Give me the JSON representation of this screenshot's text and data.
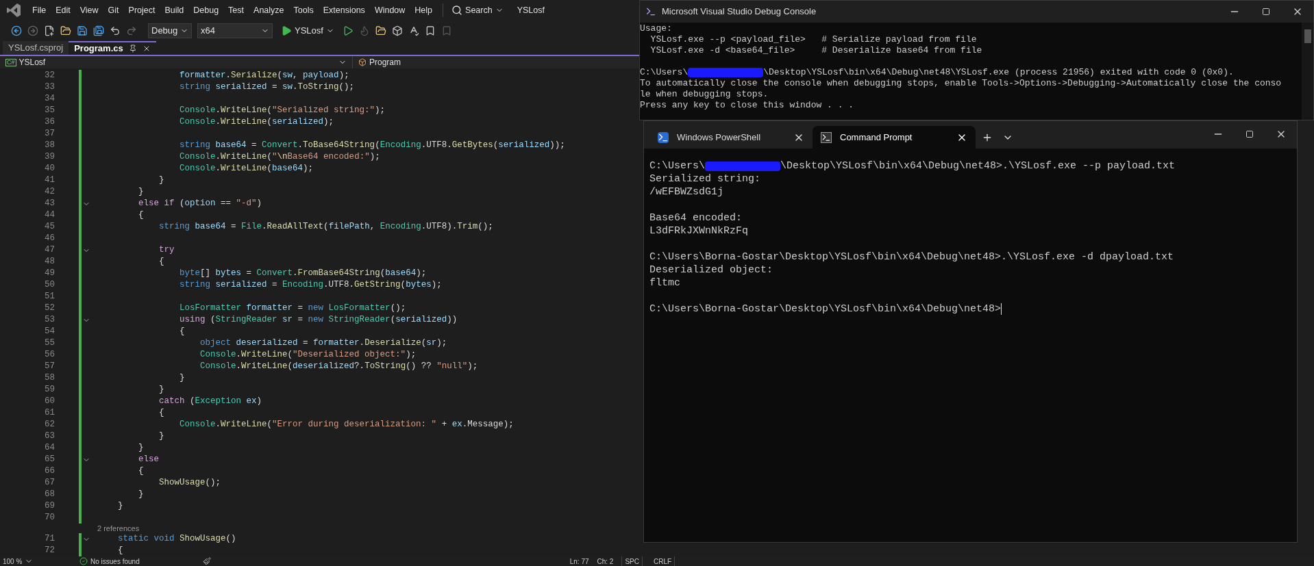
{
  "menu": [
    "File",
    "Edit",
    "View",
    "Git",
    "Project",
    "Build",
    "Debug",
    "Test",
    "Analyze",
    "Tools",
    "Extensions",
    "Window",
    "Help"
  ],
  "search": "Search",
  "solution_name": "YSLosf",
  "toolbar": {
    "configuration": "Debug",
    "platform": "x64",
    "run_target": "YSLosf"
  },
  "tabs": [
    {
      "label": "YSLosf.csproj",
      "selected": false
    },
    {
      "label": "Program.cs",
      "selected": true
    }
  ],
  "nav_bar": {
    "language_badge": "C#",
    "project": "YSLosf",
    "member": "Program"
  },
  "editor": {
    "lines": [
      {
        "n": "32",
        "fold": false,
        "tokens": [
          {
            "kind": "var",
            "text": "                formatter"
          },
          {
            "kind": "pl",
            "text": "."
          },
          {
            "kind": "m",
            "text": "Serialize"
          },
          {
            "kind": "pl",
            "text": "("
          },
          {
            "kind": "var",
            "text": "sw"
          },
          {
            "kind": "pl",
            "text": ", "
          },
          {
            "kind": "var",
            "text": "payload"
          },
          {
            "kind": "pl",
            "text": ");"
          }
        ]
      },
      {
        "n": "33",
        "fold": false,
        "tokens": [
          {
            "kind": "kw",
            "text": "                string"
          },
          {
            "kind": "var",
            "text": " serialized"
          },
          {
            "kind": "pl",
            "text": " = "
          },
          {
            "kind": "var",
            "text": "sw"
          },
          {
            "kind": "pl",
            "text": "."
          },
          {
            "kind": "m",
            "text": "ToString"
          },
          {
            "kind": "pl",
            "text": "();"
          }
        ]
      },
      {
        "n": "34",
        "fold": false
      },
      {
        "n": "35",
        "fold": false,
        "tokens": [
          {
            "kind": "ty",
            "text": "                Console"
          },
          {
            "kind": "pl",
            "text": "."
          },
          {
            "kind": "m",
            "text": "WriteLine"
          },
          {
            "kind": "pl",
            "text": "("
          },
          {
            "kind": "s",
            "text": "\"Serialized string:\""
          },
          {
            "kind": "pl",
            "text": ");"
          }
        ]
      },
      {
        "n": "36",
        "fold": false,
        "tokens": [
          {
            "kind": "ty",
            "text": "                Console"
          },
          {
            "kind": "pl",
            "text": "."
          },
          {
            "kind": "m",
            "text": "WriteLine"
          },
          {
            "kind": "pl",
            "text": "("
          },
          {
            "kind": "var",
            "text": "serialized"
          },
          {
            "kind": "pl",
            "text": ");"
          }
        ]
      },
      {
        "n": "37",
        "fold": false
      },
      {
        "n": "38",
        "fold": false,
        "tokens": [
          {
            "kind": "kw",
            "text": "                string"
          },
          {
            "kind": "var",
            "text": " base64"
          },
          {
            "kind": "pl",
            "text": " = "
          },
          {
            "kind": "ty",
            "text": "Convert"
          },
          {
            "kind": "pl",
            "text": "."
          },
          {
            "kind": "m",
            "text": "ToBase64String"
          },
          {
            "kind": "pl",
            "text": "("
          },
          {
            "kind": "ty",
            "text": "Encoding"
          },
          {
            "kind": "pl",
            "text": ".UTF8."
          },
          {
            "kind": "m",
            "text": "GetBytes"
          },
          {
            "kind": "pl",
            "text": "("
          },
          {
            "kind": "var",
            "text": "serialized"
          },
          {
            "kind": "pl",
            "text": "));"
          }
        ]
      },
      {
        "n": "39",
        "fold": false,
        "tokens": [
          {
            "kind": "ty",
            "text": "                Console"
          },
          {
            "kind": "pl",
            "text": "."
          },
          {
            "kind": "m",
            "text": "WriteLine"
          },
          {
            "kind": "pl",
            "text": "("
          },
          {
            "kind": "s",
            "text": "\""
          },
          {
            "kind": "esc",
            "text": "\\n"
          },
          {
            "kind": "s",
            "text": "Base64 encoded:\""
          },
          {
            "kind": "pl",
            "text": ");"
          }
        ]
      },
      {
        "n": "40",
        "fold": false,
        "tokens": [
          {
            "kind": "ty",
            "text": "                Console"
          },
          {
            "kind": "pl",
            "text": "."
          },
          {
            "kind": "m",
            "text": "WriteLine"
          },
          {
            "kind": "pl",
            "text": "("
          },
          {
            "kind": "var",
            "text": "base64"
          },
          {
            "kind": "pl",
            "text": ");"
          }
        ]
      },
      {
        "n": "41",
        "fold": false,
        "tokens": [
          {
            "kind": "pl",
            "text": "            }"
          }
        ]
      },
      {
        "n": "42",
        "fold": false,
        "tokens": [
          {
            "kind": "pl",
            "text": "        }"
          }
        ]
      },
      {
        "n": "43",
        "fold": true,
        "tokens": [
          {
            "kind": "ctl",
            "text": "        else if"
          },
          {
            "kind": "pl",
            "text": " ("
          },
          {
            "kind": "var",
            "text": "option"
          },
          {
            "kind": "pl",
            "text": " == "
          },
          {
            "kind": "s",
            "text": "\"-d\""
          },
          {
            "kind": "pl",
            "text": ")"
          }
        ]
      },
      {
        "n": "44",
        "fold": false,
        "tokens": [
          {
            "kind": "pl",
            "text": "        {"
          }
        ]
      },
      {
        "n": "45",
        "fold": false,
        "tokens": [
          {
            "kind": "kw",
            "text": "            string"
          },
          {
            "kind": "var",
            "text": " base64"
          },
          {
            "kind": "pl",
            "text": " = "
          },
          {
            "kind": "ty",
            "text": "File"
          },
          {
            "kind": "pl",
            "text": "."
          },
          {
            "kind": "m",
            "text": "ReadAllText"
          },
          {
            "kind": "pl",
            "text": "("
          },
          {
            "kind": "var",
            "text": "filePath"
          },
          {
            "kind": "pl",
            "text": ", "
          },
          {
            "kind": "ty",
            "text": "Encoding"
          },
          {
            "kind": "pl",
            "text": ".UTF8)."
          },
          {
            "kind": "m",
            "text": "Trim"
          },
          {
            "kind": "pl",
            "text": "();"
          }
        ]
      },
      {
        "n": "46",
        "fold": false
      },
      {
        "n": "47",
        "fold": true,
        "tokens": [
          {
            "kind": "ctl",
            "text": "            try"
          }
        ]
      },
      {
        "n": "48",
        "fold": false,
        "tokens": [
          {
            "kind": "pl",
            "text": "            {"
          }
        ]
      },
      {
        "n": "49",
        "fold": false,
        "tokens": [
          {
            "kind": "kw",
            "text": "                byte"
          },
          {
            "kind": "pl",
            "text": "[] "
          },
          {
            "kind": "var",
            "text": "bytes"
          },
          {
            "kind": "pl",
            "text": " = "
          },
          {
            "kind": "ty",
            "text": "Convert"
          },
          {
            "kind": "pl",
            "text": "."
          },
          {
            "kind": "m",
            "text": "FromBase64String"
          },
          {
            "kind": "pl",
            "text": "("
          },
          {
            "kind": "var",
            "text": "base64"
          },
          {
            "kind": "pl",
            "text": ");"
          }
        ]
      },
      {
        "n": "50",
        "fold": false,
        "tokens": [
          {
            "kind": "kw",
            "text": "                string"
          },
          {
            "kind": "var",
            "text": " serialized"
          },
          {
            "kind": "pl",
            "text": " = "
          },
          {
            "kind": "ty",
            "text": "Encoding"
          },
          {
            "kind": "pl",
            "text": ".UTF8."
          },
          {
            "kind": "m",
            "text": "GetString"
          },
          {
            "kind": "pl",
            "text": "("
          },
          {
            "kind": "var",
            "text": "bytes"
          },
          {
            "kind": "pl",
            "text": ");"
          }
        ]
      },
      {
        "n": "51",
        "fold": false
      },
      {
        "n": "52",
        "fold": false,
        "tokens": [
          {
            "kind": "ty",
            "text": "                LosFormatter"
          },
          {
            "kind": "var",
            "text": " formatter"
          },
          {
            "kind": "pl",
            "text": " = "
          },
          {
            "kind": "kw",
            "text": "new"
          },
          {
            "kind": "ty",
            "text": " LosFormatter"
          },
          {
            "kind": "pl",
            "text": "();"
          }
        ]
      },
      {
        "n": "53",
        "fold": true,
        "tokens": [
          {
            "kind": "ctl",
            "text": "                using"
          },
          {
            "kind": "pl",
            "text": " ("
          },
          {
            "kind": "ty",
            "text": "StringReader"
          },
          {
            "kind": "var",
            "text": " sr"
          },
          {
            "kind": "pl",
            "text": " = "
          },
          {
            "kind": "kw",
            "text": "new"
          },
          {
            "kind": "ty",
            "text": " StringReader"
          },
          {
            "kind": "pl",
            "text": "("
          },
          {
            "kind": "var",
            "text": "serialized"
          },
          {
            "kind": "pl",
            "text": "))"
          }
        ]
      },
      {
        "n": "54",
        "fold": false,
        "tokens": [
          {
            "kind": "pl",
            "text": "                {"
          }
        ]
      },
      {
        "n": "55",
        "fold": false,
        "tokens": [
          {
            "kind": "kw",
            "text": "                    object"
          },
          {
            "kind": "var",
            "text": " deserialized"
          },
          {
            "kind": "pl",
            "text": " = "
          },
          {
            "kind": "var",
            "text": "formatter"
          },
          {
            "kind": "pl",
            "text": "."
          },
          {
            "kind": "m",
            "text": "Deserialize"
          },
          {
            "kind": "pl",
            "text": "("
          },
          {
            "kind": "var",
            "text": "sr"
          },
          {
            "kind": "pl",
            "text": ");"
          }
        ]
      },
      {
        "n": "56",
        "fold": false,
        "tokens": [
          {
            "kind": "ty",
            "text": "                    Console"
          },
          {
            "kind": "pl",
            "text": "."
          },
          {
            "kind": "m",
            "text": "WriteLine"
          },
          {
            "kind": "pl",
            "text": "("
          },
          {
            "kind": "s",
            "text": "\"Deserialized object:\""
          },
          {
            "kind": "pl",
            "text": ");"
          }
        ]
      },
      {
        "n": "57",
        "fold": false,
        "tokens": [
          {
            "kind": "ty",
            "text": "                    Console"
          },
          {
            "kind": "pl",
            "text": "."
          },
          {
            "kind": "m",
            "text": "WriteLine"
          },
          {
            "kind": "pl",
            "text": "("
          },
          {
            "kind": "var",
            "text": "deserialized"
          },
          {
            "kind": "pl",
            "text": "?."
          },
          {
            "kind": "m",
            "text": "ToString"
          },
          {
            "kind": "pl",
            "text": "() ?? "
          },
          {
            "kind": "s",
            "text": "\"null\""
          },
          {
            "kind": "pl",
            "text": ");"
          }
        ]
      },
      {
        "n": "58",
        "fold": false,
        "tokens": [
          {
            "kind": "pl",
            "text": "                }"
          }
        ]
      },
      {
        "n": "59",
        "fold": false,
        "tokens": [
          {
            "kind": "pl",
            "text": "            }"
          }
        ]
      },
      {
        "n": "60",
        "fold": false,
        "tokens": [
          {
            "kind": "ctl",
            "text": "            catch"
          },
          {
            "kind": "pl",
            "text": " ("
          },
          {
            "kind": "ty",
            "text": "Exception"
          },
          {
            "kind": "var",
            "text": " ex"
          },
          {
            "kind": "pl",
            "text": ")"
          }
        ]
      },
      {
        "n": "61",
        "fold": false,
        "tokens": [
          {
            "kind": "pl",
            "text": "            {"
          }
        ]
      },
      {
        "n": "62",
        "fold": false,
        "tokens": [
          {
            "kind": "ty",
            "text": "                Console"
          },
          {
            "kind": "pl",
            "text": "."
          },
          {
            "kind": "m",
            "text": "WriteLine"
          },
          {
            "kind": "pl",
            "text": "("
          },
          {
            "kind": "s",
            "text": "\"Error during deserialization: \""
          },
          {
            "kind": "pl",
            "text": " + "
          },
          {
            "kind": "var",
            "text": "ex"
          },
          {
            "kind": "pl",
            "text": ".Message);"
          }
        ]
      },
      {
        "n": "63",
        "fold": false,
        "tokens": [
          {
            "kind": "pl",
            "text": "            }"
          }
        ]
      },
      {
        "n": "64",
        "fold": false,
        "tokens": [
          {
            "kind": "pl",
            "text": "        }"
          }
        ]
      },
      {
        "n": "65",
        "fold": true,
        "tokens": [
          {
            "kind": "ctl",
            "text": "        else"
          }
        ]
      },
      {
        "n": "66",
        "fold": false,
        "tokens": [
          {
            "kind": "pl",
            "text": "        {"
          }
        ]
      },
      {
        "n": "67",
        "fold": false,
        "tokens": [
          {
            "kind": "m",
            "text": "            ShowUsage"
          },
          {
            "kind": "pl",
            "text": "();"
          }
        ]
      },
      {
        "n": "68",
        "fold": false,
        "tokens": [
          {
            "kind": "pl",
            "text": "        }"
          }
        ]
      },
      {
        "n": "69",
        "fold": false,
        "tokens": [
          {
            "kind": "pl",
            "text": "    }"
          }
        ]
      },
      {
        "n": "70",
        "fold": false
      },
      {
        "n": "71",
        "fold": true,
        "codelens": "2 references",
        "tokens": [
          {
            "kind": "kw",
            "text": "    static void"
          },
          {
            "kind": "m",
            "text": " ShowUsage"
          },
          {
            "kind": "pl",
            "text": "()"
          }
        ]
      },
      {
        "n": "72",
        "fold": false,
        "tokens": [
          {
            "kind": "pl",
            "text": "    {"
          }
        ]
      }
    ]
  },
  "status_bar": {
    "zoom": "100 %",
    "issues": "No issues found",
    "line": "Ln: 77",
    "column": "Ch: 2",
    "whitespace": "SPC",
    "line_ending": "CRLF"
  },
  "debug_console": {
    "title": "Microsoft Visual Studio Debug Console",
    "lines": [
      {
        "kind": "text",
        "text": "Usage:"
      },
      {
        "kind": "text",
        "text": "  YSLosf.exe --p <payload_file>   # Serialize payload from file"
      },
      {
        "kind": "text",
        "text": "  YSLosf.exe -d <base64_file>     # Deserialize base64 from file"
      },
      {
        "kind": "blank"
      },
      {
        "kind": "redacted",
        "before": "C:\\Users\\",
        "after": "\\Desktop\\YSLosf\\bin\\x64\\Debug\\net48\\YSLosf.exe (process 21956) exited with code 0 (0x0)."
      },
      {
        "kind": "text",
        "text": "To automatically close the console when debugging stops, enable Tools->Options->Debugging->Automatically close the conso"
      },
      {
        "kind": "text",
        "text": "le when debugging stops."
      },
      {
        "kind": "text",
        "text": "Press any key to close this window . . ."
      }
    ]
  },
  "terminal": {
    "tabs": [
      {
        "label": "Windows PowerShell",
        "selected": false,
        "kind": "powershell"
      },
      {
        "label": "Command Prompt",
        "selected": true,
        "kind": "cmd"
      }
    ],
    "cursor": true,
    "lines": [
      {
        "kind": "redacted",
        "before": "C:\\Users\\",
        "after": "\\Desktop\\YSLosf\\bin\\x64\\Debug\\net48>.\\YSLosf.exe --p payload.txt"
      },
      {
        "kind": "text",
        "text": "Serialized string:"
      },
      {
        "kind": "text",
        "text": "/wEFBWZsdG1j"
      },
      {
        "kind": "blank"
      },
      {
        "kind": "text",
        "text": "Base64 encoded:"
      },
      {
        "kind": "text",
        "text": "L3dFRkJXWnNkRzFq"
      },
      {
        "kind": "blank"
      },
      {
        "kind": "text",
        "text": "C:\\Users\\Borna-Gostar\\Desktop\\YSLosf\\bin\\x64\\Debug\\net48>.\\YSLosf.exe -d dpayload.txt"
      },
      {
        "kind": "text",
        "text": "Deserialized object:"
      },
      {
        "kind": "text",
        "text": "fltmc"
      },
      {
        "kind": "blank"
      },
      {
        "kind": "text",
        "text": "C:\\Users\\Borna-Gostar\\Desktop\\YSLosf\\bin\\x64\\Debug\\net48>"
      }
    ]
  }
}
